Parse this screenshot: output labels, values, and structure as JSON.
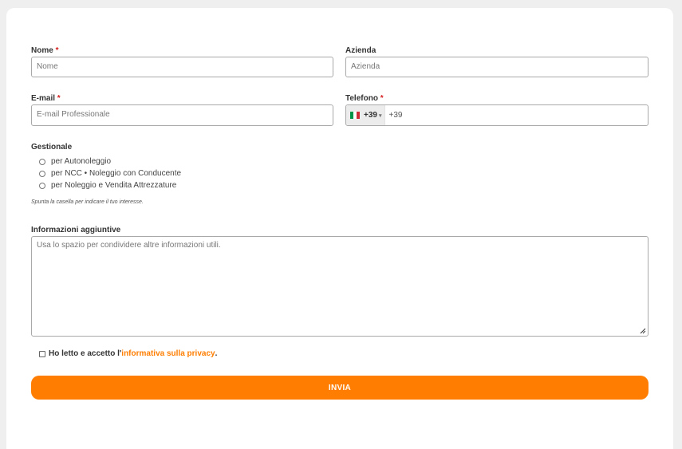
{
  "form": {
    "nome": {
      "label": "Nome",
      "required_mark": "*",
      "placeholder": "Nome"
    },
    "azienda": {
      "label": "Azienda",
      "placeholder": "Azienda"
    },
    "email": {
      "label": "E-mail",
      "required_mark": "*",
      "placeholder": "E-mail Professionale"
    },
    "telefono": {
      "label": "Telefono",
      "required_mark": "*",
      "country_flag": "italy-flag",
      "country_code": "+39",
      "value": "+39"
    },
    "gestionale": {
      "label": "Gestionale",
      "options": [
        "per Autonoleggio",
        "per NCC • Noleggio con Conducente",
        "per Noleggio e Vendita Attrezzature"
      ],
      "hint": "Spunta la casella per indicare il tuo interesse."
    },
    "informazioni": {
      "label": "Informazioni aggiuntive",
      "placeholder": "Usa lo spazio per condividere altre informazioni utili."
    },
    "privacy": {
      "prefix": "Ho letto e accetto l'",
      "link_text": "informativa sulla privacy",
      "suffix": "."
    },
    "submit_label": "INVIA"
  },
  "colors": {
    "accent": "#ff7d00",
    "required": "#d61f1f"
  }
}
